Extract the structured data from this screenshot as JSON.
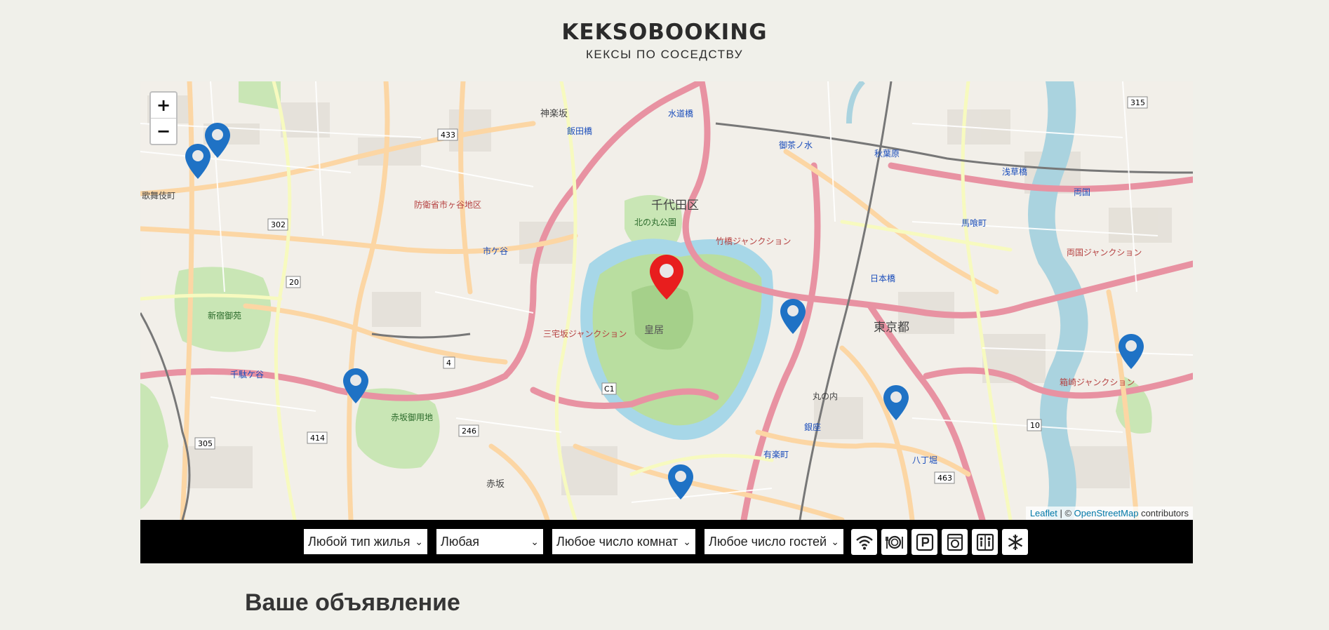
{
  "header": {
    "logo": "KEKSOBOOKING",
    "tagline": "КЕКСЫ ПО СОСЕДСТВУ"
  },
  "map": {
    "zoom_in": "+",
    "zoom_out": "−",
    "attribution": {
      "leaflet": "Leaflet",
      "sep": " | © ",
      "osm": "OpenStreetMap",
      "suffix": " contributors"
    },
    "labels": [
      "千代田区",
      "東京都",
      "神楽坂",
      "飯田橋",
      "水道橋",
      "御茶ノ水",
      "秋葉原",
      "浅草橋",
      "両国",
      "馬喰町",
      "市ケ谷",
      "皇居",
      "有楽町",
      "銀座",
      "八丁堀",
      "新宿御苑",
      "赤坂御用地",
      "赤坂",
      "千駄ケ谷",
      "防衛省市ヶ谷地区",
      "北の丸公園",
      "三宅坂ジャンクション",
      "竹橋ジャンクション",
      "両国ジャンクション",
      "箱崎ジャンクション",
      "丸の内",
      "日本橋",
      "歌舞伎町"
    ],
    "main_pin_color": "#e81e1e",
    "pin_color": "#1f72c5"
  },
  "filters": {
    "housing_type": "Любой тип жилья",
    "price": "Любая",
    "rooms": "Любое число комнат",
    "guests": "Любое число гостей",
    "features": [
      "wifi-icon",
      "dishwasher-icon",
      "parking-icon",
      "washer-icon",
      "elevator-icon",
      "conditioner-icon"
    ]
  },
  "notice": {
    "title": "Ваше объявление"
  }
}
